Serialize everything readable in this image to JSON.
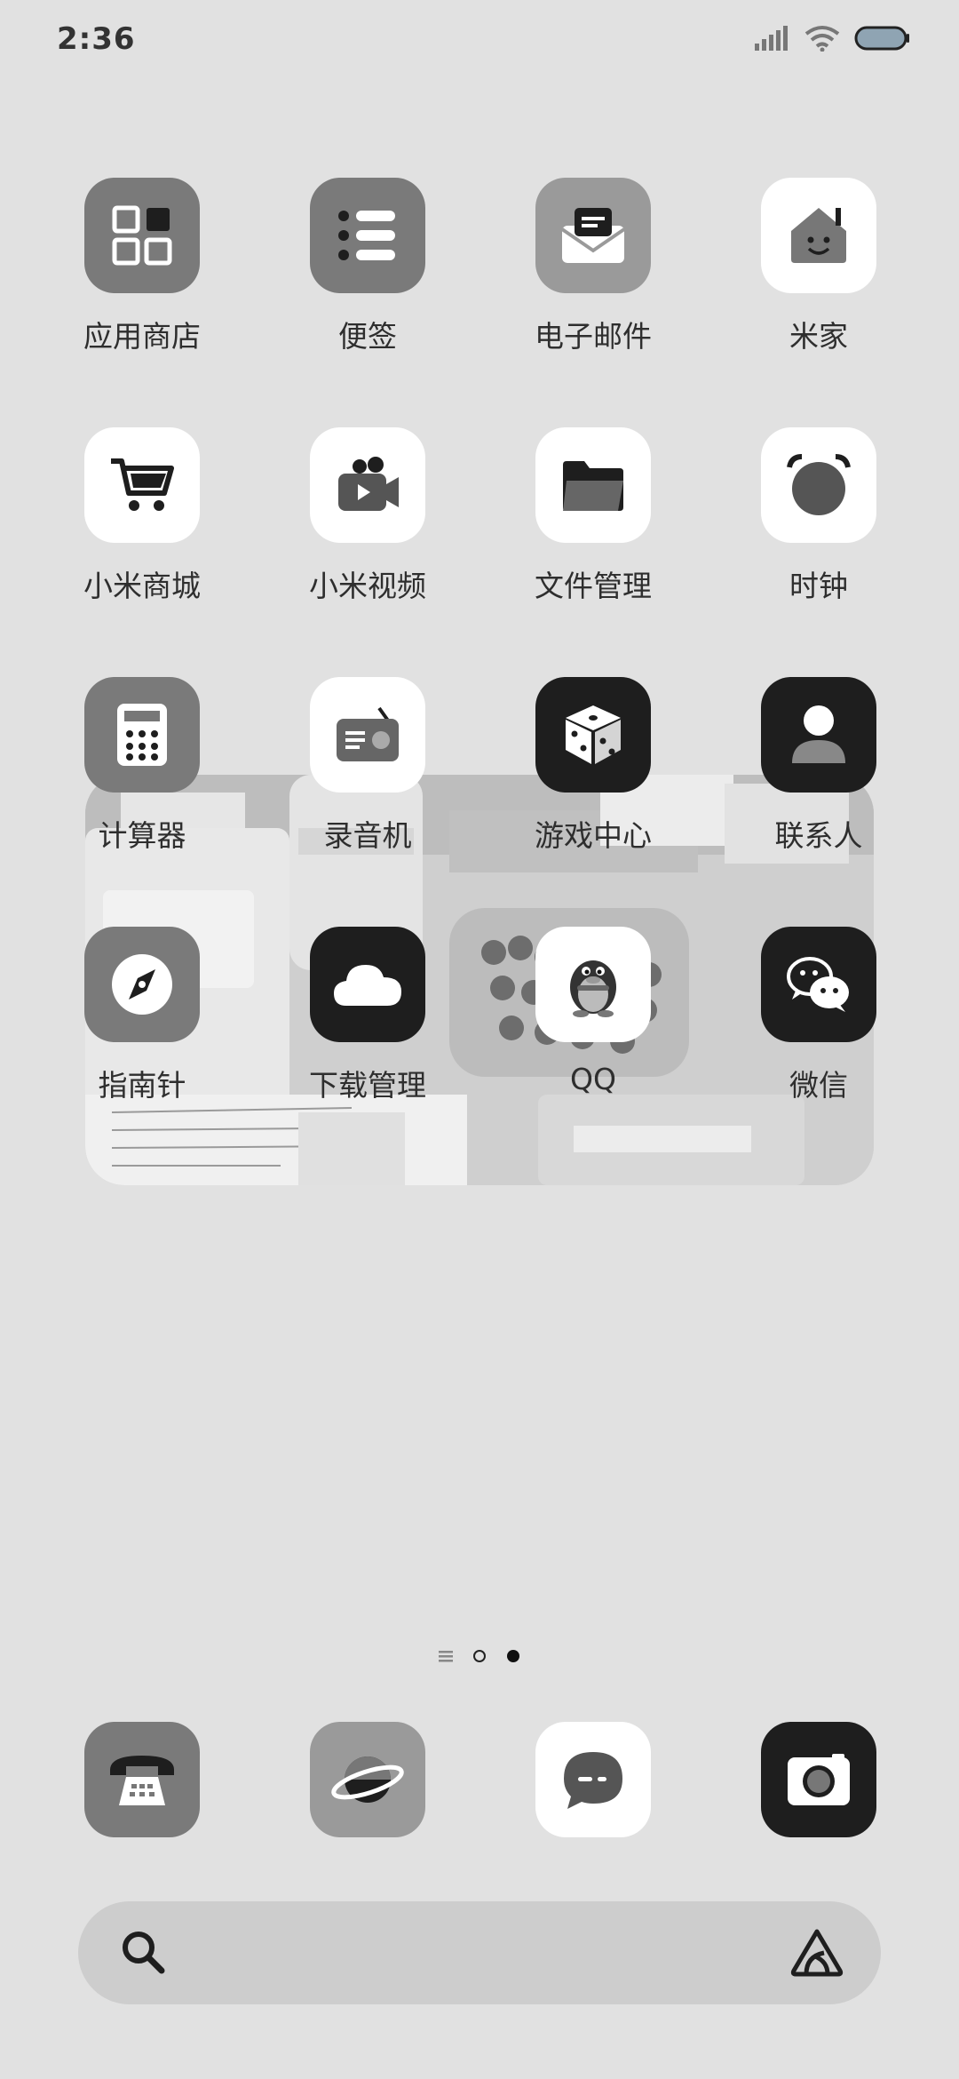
{
  "status": {
    "time": "2:36"
  },
  "apps": [
    {
      "label": "应用商店",
      "icon": "app-store-icon"
    },
    {
      "label": "便签",
      "icon": "notes-icon"
    },
    {
      "label": "电子邮件",
      "icon": "email-icon"
    },
    {
      "label": "米家",
      "icon": "mi-home-icon"
    },
    {
      "label": "小米商城",
      "icon": "shopping-cart-icon"
    },
    {
      "label": "小米视频",
      "icon": "video-camera-icon"
    },
    {
      "label": "文件管理",
      "icon": "folder-icon"
    },
    {
      "label": "时钟",
      "icon": "alarm-clock-icon"
    },
    {
      "label": "计算器",
      "icon": "calculator-icon"
    },
    {
      "label": "录音机",
      "icon": "radio-icon"
    },
    {
      "label": "游戏中心",
      "icon": "dice-icon"
    },
    {
      "label": "联系人",
      "icon": "person-icon"
    },
    {
      "label": "指南针",
      "icon": "compass-icon"
    },
    {
      "label": "下载管理",
      "icon": "cloud-icon"
    },
    {
      "label": "QQ",
      "icon": "penguin-icon"
    },
    {
      "label": "微信",
      "icon": "wechat-icon"
    }
  ],
  "dock": [
    "phone-icon",
    "browser-planet-icon",
    "messages-icon",
    "camera-icon"
  ],
  "page_indicator": {
    "pages": 2,
    "active": 2
  },
  "colors": {
    "background": "#e1e1e1",
    "dark": "#1e1e1e",
    "mid": "#7a7a7a",
    "light": "#9a9a9a",
    "white": "#ffffff"
  }
}
